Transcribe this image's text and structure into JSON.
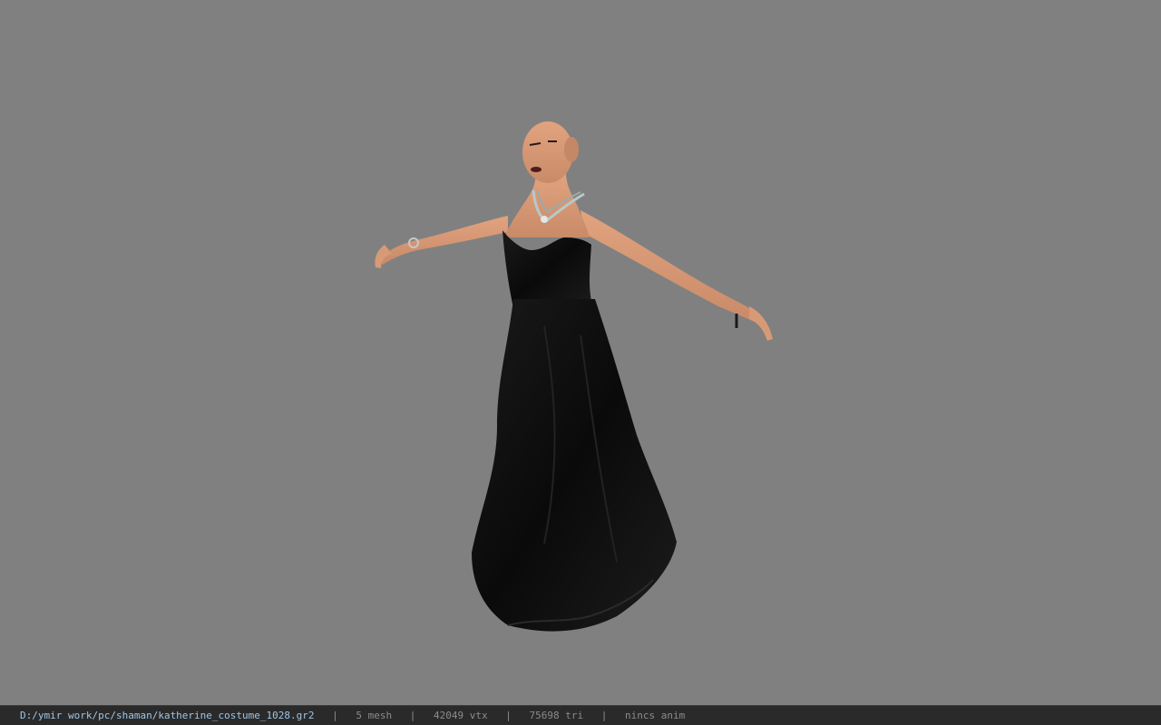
{
  "viewer": {
    "background_color": "#808080",
    "model_icon": "character-model"
  },
  "status_bar": {
    "file_path": "D:/ymir work/pc/shaman/katherine_costume_1028.gr2",
    "separator": "|",
    "mesh_count": "5 mesh",
    "vertex_count": "42049 vtx",
    "triangle_count": "75698 tri",
    "animation": "nincs anim"
  }
}
